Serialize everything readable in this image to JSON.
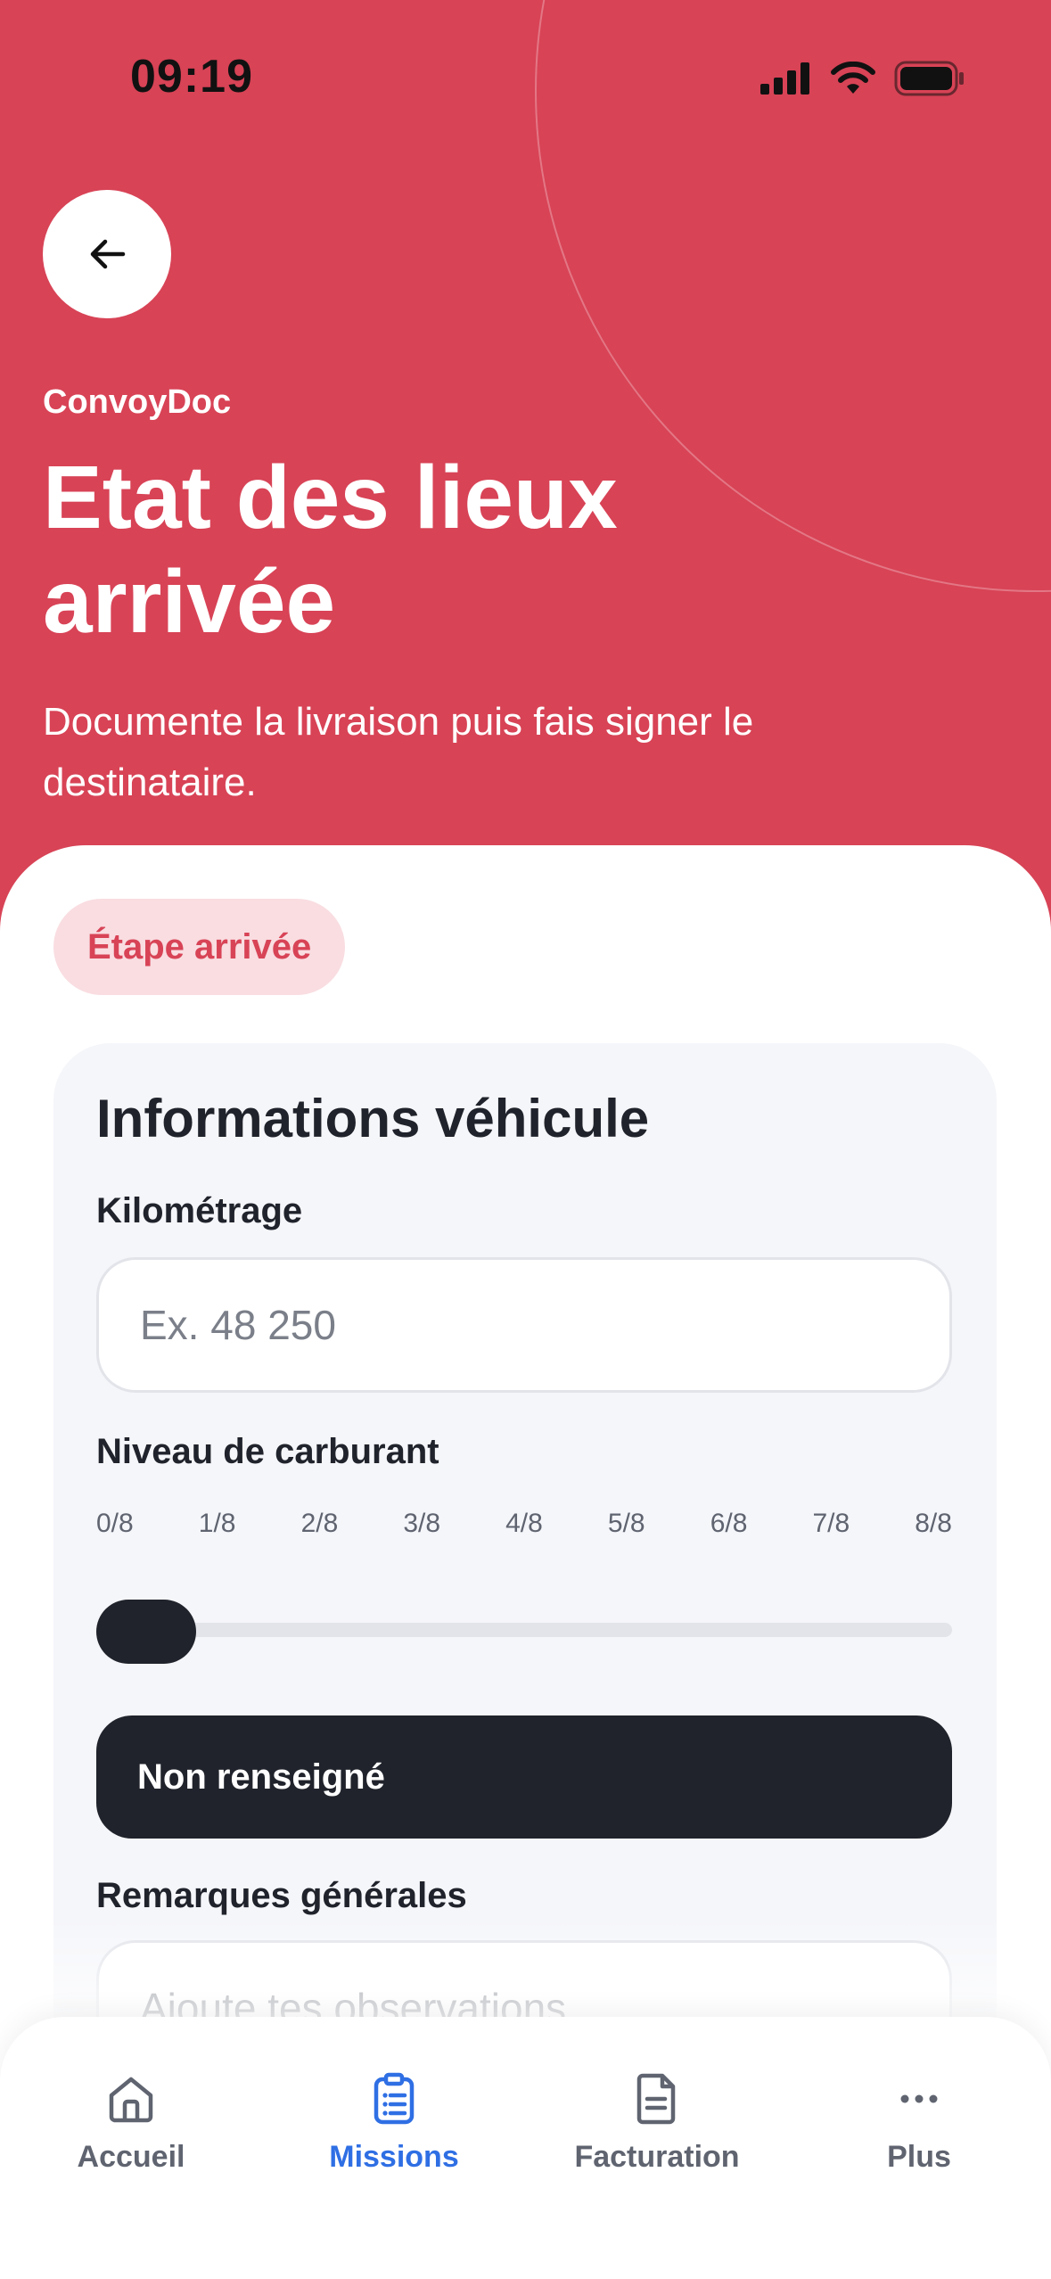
{
  "status_bar": {
    "time": "09:19"
  },
  "header": {
    "app_name": "ConvoyDoc",
    "title": "Etat des lieux arrivée",
    "subtitle": "Documente la livraison puis fais signer le destinataire."
  },
  "step_badge": "Étape arrivée",
  "vehicle_card": {
    "title": "Informations véhicule",
    "mileage": {
      "label": "Kilométrage",
      "placeholder": "Ex. 48 250",
      "value": ""
    },
    "fuel": {
      "label": "Niveau de carburant",
      "ticks": [
        "0/8",
        "1/8",
        "2/8",
        "3/8",
        "4/8",
        "5/8",
        "6/8",
        "7/8",
        "8/8"
      ],
      "level_eighths": 0,
      "value_label": "Non renseigné"
    },
    "remarks": {
      "label": "Remarques générales",
      "placeholder": "Ajoute tes observations",
      "value": ""
    }
  },
  "tabbar": {
    "active": "missions",
    "items": [
      {
        "id": "accueil",
        "label": "Accueil",
        "icon": "home-icon"
      },
      {
        "id": "missions",
        "label": "Missions",
        "icon": "clipboard-list-icon"
      },
      {
        "id": "facturation",
        "label": "Facturation",
        "icon": "document-icon"
      },
      {
        "id": "plus",
        "label": "Plus",
        "icon": "more-icon"
      }
    ]
  },
  "colors": {
    "brand_red": "#d84356",
    "badge_bg": "#f9dde1",
    "dark": "#20232b",
    "active_tab": "#2f6fe4"
  }
}
